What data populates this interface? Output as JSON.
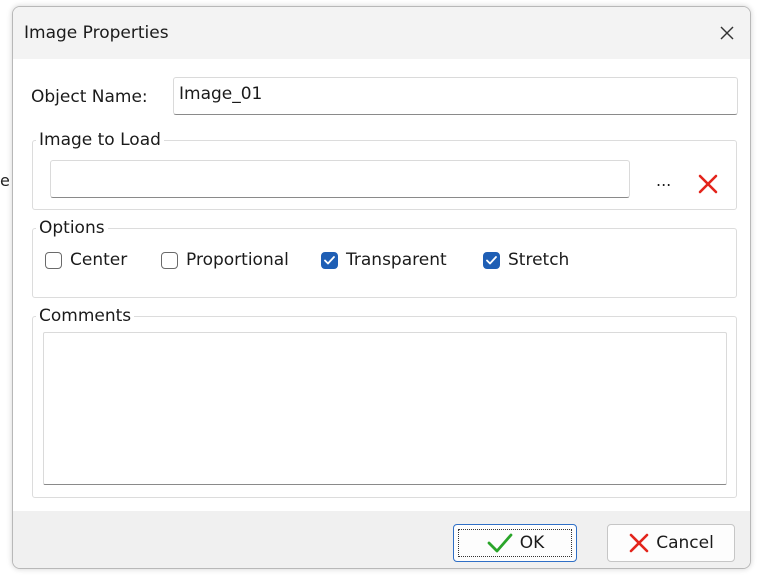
{
  "background_text": "e",
  "dialog": {
    "title": "Image Properties",
    "close_icon": "close-x-icon"
  },
  "object_name": {
    "label": "Object Name:",
    "value": "Image_01"
  },
  "image_to_load": {
    "legend": "Image to Load",
    "path_value": "",
    "browse_label": "...",
    "clear_icon": "red-x-icon"
  },
  "options": {
    "legend": "Options",
    "items": [
      {
        "label": "Center",
        "checked": false
      },
      {
        "label": "Proportional",
        "checked": false
      },
      {
        "label": "Transparent",
        "checked": true
      },
      {
        "label": "Stretch",
        "checked": true
      }
    ]
  },
  "comments": {
    "legend": "Comments",
    "value": ""
  },
  "buttons": {
    "ok_label": "OK",
    "ok_icon": "green-check-icon",
    "cancel_label": "Cancel",
    "cancel_icon": "red-x-icon"
  },
  "colors": {
    "checkbox_checked": "#1f5fb5",
    "ok_check": "#2aa52a",
    "cancel_x": "#e3241b"
  }
}
